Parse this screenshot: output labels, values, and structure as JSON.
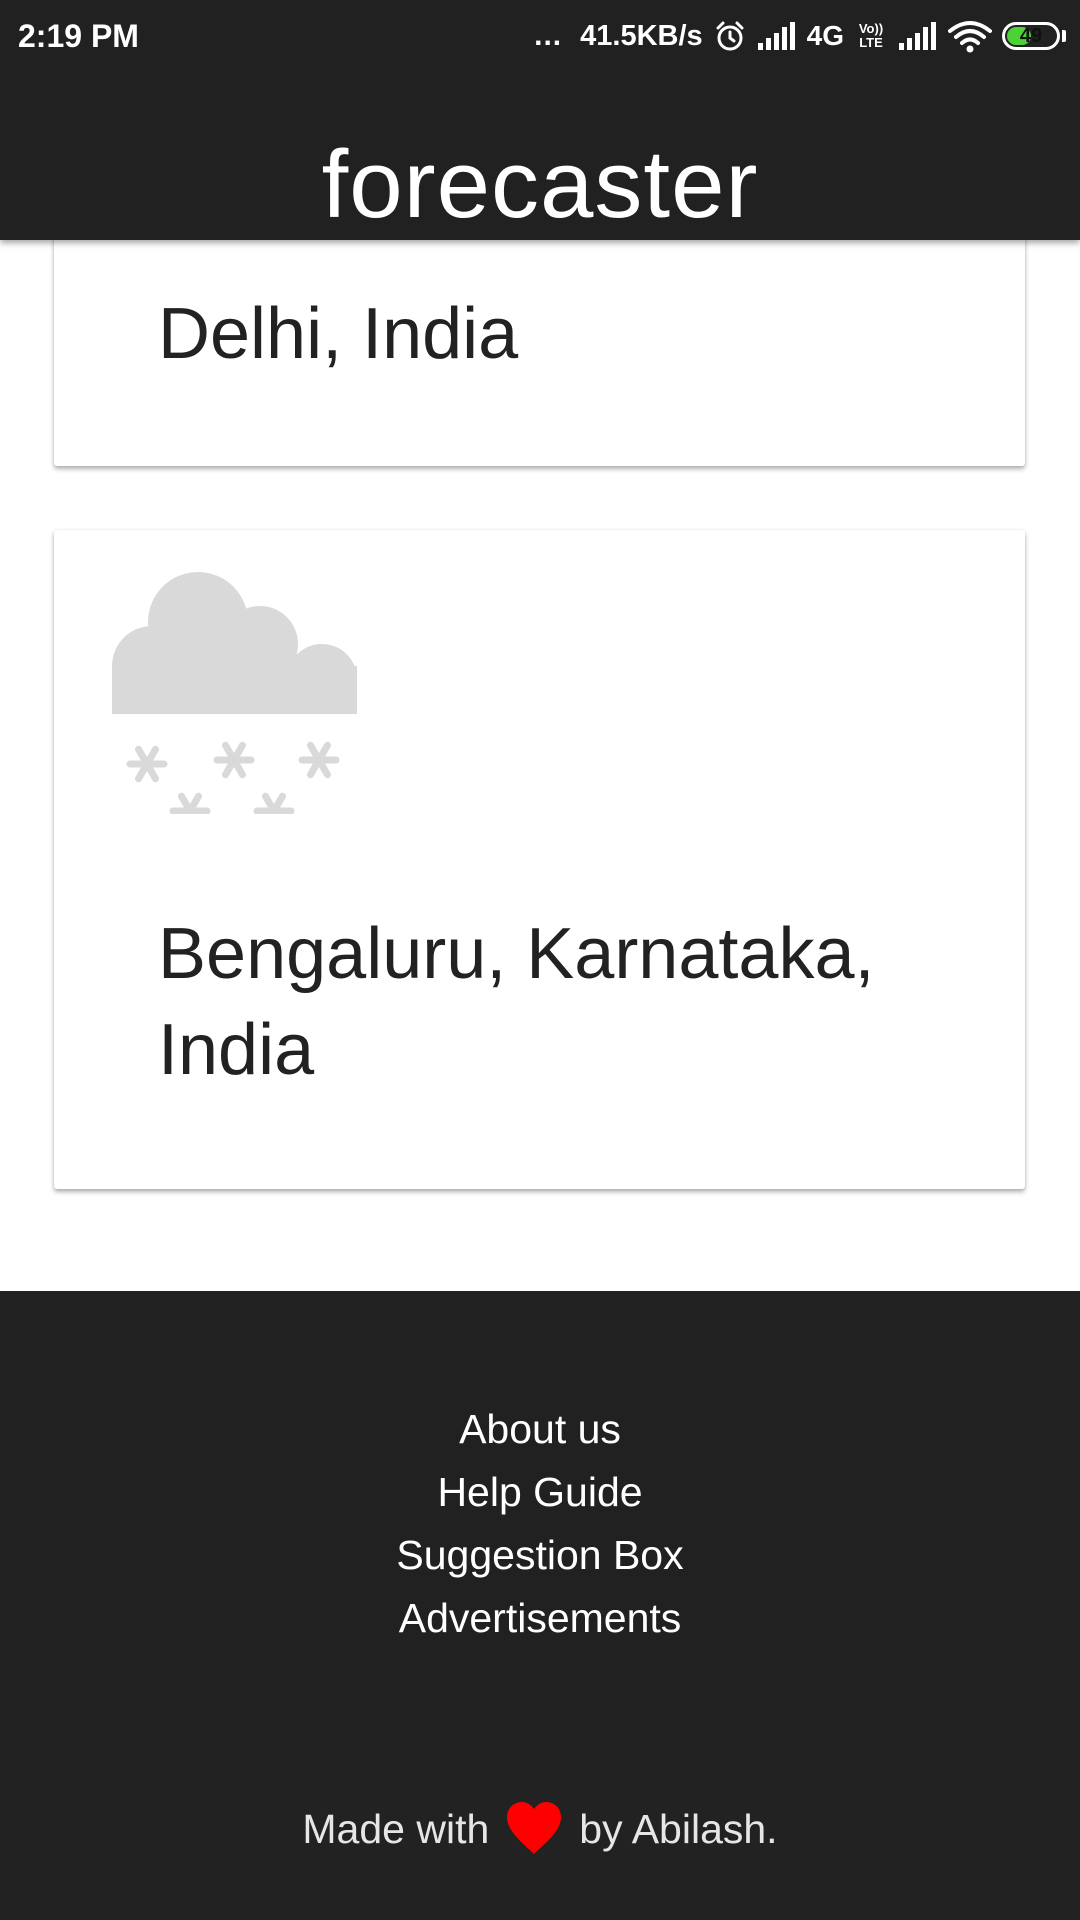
{
  "status_bar": {
    "time": "2:19 PM",
    "dots": "...",
    "speed": "41.5KB/s",
    "network": "4G",
    "volte_top": "Vo))",
    "volte_bottom": "LTE",
    "battery": "49",
    "battery_level": 0.49,
    "battery_color": "#4cd137"
  },
  "header": {
    "title": "forecaster"
  },
  "cards": [
    {
      "location": "Delhi, India"
    },
    {
      "icon": "snow-cloud-icon",
      "location": "Bengaluru, Karnataka, India"
    }
  ],
  "footer": {
    "links": [
      "About us",
      "Help Guide",
      "Suggestion Box",
      "Advertisements"
    ],
    "made_with_prefix": "Made with",
    "made_with_suffix": "by Abilash.",
    "heart_color": "#ff0000"
  },
  "colors": {
    "bar_background": "#212121",
    "card_background": "#ffffff",
    "icon_gray": "#d9d9d9"
  }
}
